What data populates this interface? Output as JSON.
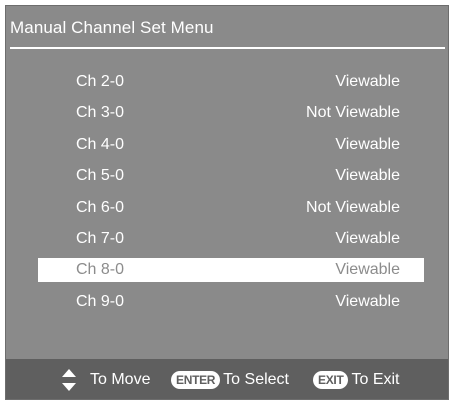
{
  "menu": {
    "title": "Manual Channel Set Menu"
  },
  "channels": [
    {
      "channel": "Ch 2-0",
      "status": "Viewable"
    },
    {
      "channel": "Ch 3-0",
      "status": "Not Viewable"
    },
    {
      "channel": "Ch 4-0",
      "status": "Viewable"
    },
    {
      "channel": "Ch 5-0",
      "status": "Viewable"
    },
    {
      "channel": "Ch 6-0",
      "status": "Not Viewable"
    },
    {
      "channel": "Ch 7-0",
      "status": "Viewable"
    },
    {
      "channel": "Ch 8-0",
      "status": "Viewable",
      "selected": true
    },
    {
      "channel": "Ch 9-0",
      "status": "Viewable"
    }
  ],
  "footer": {
    "move_label": "To Move",
    "enter_key": "ENTER",
    "select_label": "To Select",
    "exit_key": "EXIT",
    "exit_label": "To Exit",
    "move_icon": "up-down-arrows-icon"
  },
  "colors": {
    "background": "#8a8a8a",
    "footer": "#5f5f5f",
    "text": "#ffffff",
    "highlight": "#ffffff",
    "highlight_text": "#8c8c8c"
  }
}
